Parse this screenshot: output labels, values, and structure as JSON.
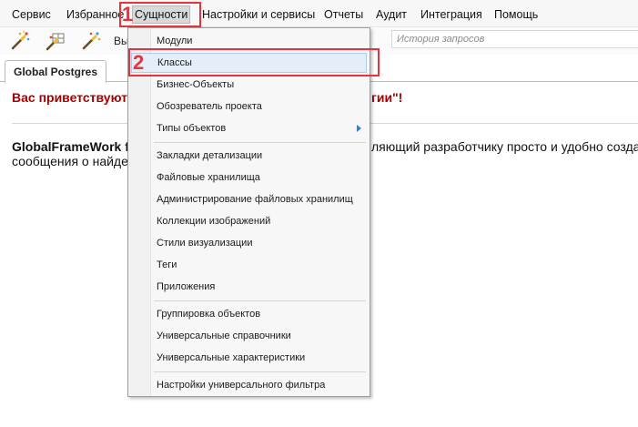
{
  "menubar": {
    "items": [
      {
        "label": "Сервис"
      },
      {
        "label": "Избранное"
      },
      {
        "label": "Сущности"
      },
      {
        "label": "Настройки и сервисы"
      },
      {
        "label": "Отчеты"
      },
      {
        "label": "Аудит"
      },
      {
        "label": "Интеграция"
      },
      {
        "label": "Помощь"
      }
    ]
  },
  "toolbar": {
    "buttons": [
      {
        "icon": "magic-wand-icon"
      },
      {
        "icon": "magic-wand-grid-icon"
      },
      {
        "icon": "magic-wand-icon"
      }
    ],
    "text_fragment": "Вы",
    "history": {
      "placeholder": "История запросов",
      "value": ""
    }
  },
  "tabs": [
    {
      "label": "Global Postgres"
    }
  ],
  "content": {
    "welcome_start": "Вас приветствуют р",
    "welcome_end": "гии\"!",
    "desc_bold": "GlobalFrameWork fo",
    "desc_end": "ляющий разработчику просто и удобно создавать",
    "desc_line2": "сообщения о найден"
  },
  "dropdown": {
    "items": [
      {
        "label": "Модули"
      },
      {
        "label": "Классы"
      },
      {
        "label": "Бизнес-Объекты"
      },
      {
        "label": "Обозреватель проекта"
      },
      {
        "label": "Типы объектов"
      },
      {
        "label": "Закладки детализации"
      },
      {
        "label": "Файловые хранилища"
      },
      {
        "label": "Администрирование файловых хранилищ"
      },
      {
        "label": "Коллекции изображений"
      },
      {
        "label": "Стили визуализации"
      },
      {
        "label": "Теги"
      },
      {
        "label": "Приложения"
      },
      {
        "label": "Группировка объектов"
      },
      {
        "label": "Универсальные справочники"
      },
      {
        "label": "Универсальные характеристики"
      },
      {
        "label": "Настройки универсального фильтра"
      }
    ]
  },
  "annotations": [
    {
      "number": "1"
    },
    {
      "number": "2"
    }
  ],
  "colors": {
    "welcome_text": "#a80000",
    "annotation": "#e8323c",
    "highlight_bg": "#e4eef8",
    "submenu_arrow": "#3b7ad4"
  }
}
